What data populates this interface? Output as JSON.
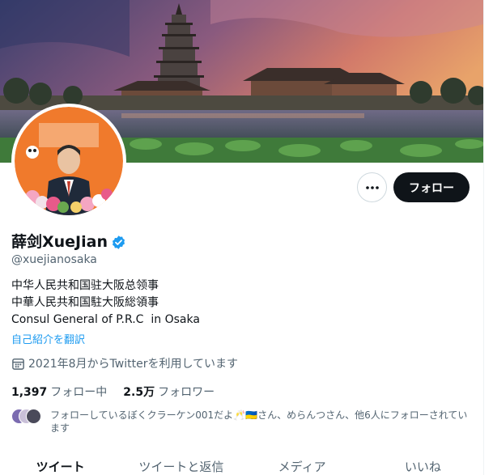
{
  "profile": {
    "display_name": "薛剑XueJian",
    "handle": "@xuejianosaka",
    "verified": true,
    "bio_lines": [
      "中华人民共和国驻大阪总领事",
      "中華人民共和国駐大阪総領事",
      "Consul General of P.R.C  in Osaka"
    ],
    "translate_label": "自己紹介を翻訳",
    "joined": "2021年8月からTwitterを利用しています"
  },
  "actions": {
    "follow_label": "フォロー"
  },
  "stats": {
    "following_count": "1,397",
    "following_label": "フォロー中",
    "followers_count": "2.5万",
    "followers_label": "フォロワー"
  },
  "followed_by": {
    "text": "フォローしているぼくクラーケン001だよ🥂🇺🇦さん、めらんつさん、他6人にフォローされています"
  },
  "tabs": [
    {
      "label": "ツイート",
      "active": true
    },
    {
      "label": "ツイートと返信",
      "active": false
    },
    {
      "label": "メディア",
      "active": false
    },
    {
      "label": "いいね",
      "active": false
    }
  ],
  "colors": {
    "accent": "#1d9bf0",
    "follow_button": "#0f1419",
    "secondary_text": "#536471"
  },
  "icons": {
    "more": "more-horizontal-icon",
    "verified": "verified-badge-icon",
    "calendar": "calendar-icon"
  }
}
